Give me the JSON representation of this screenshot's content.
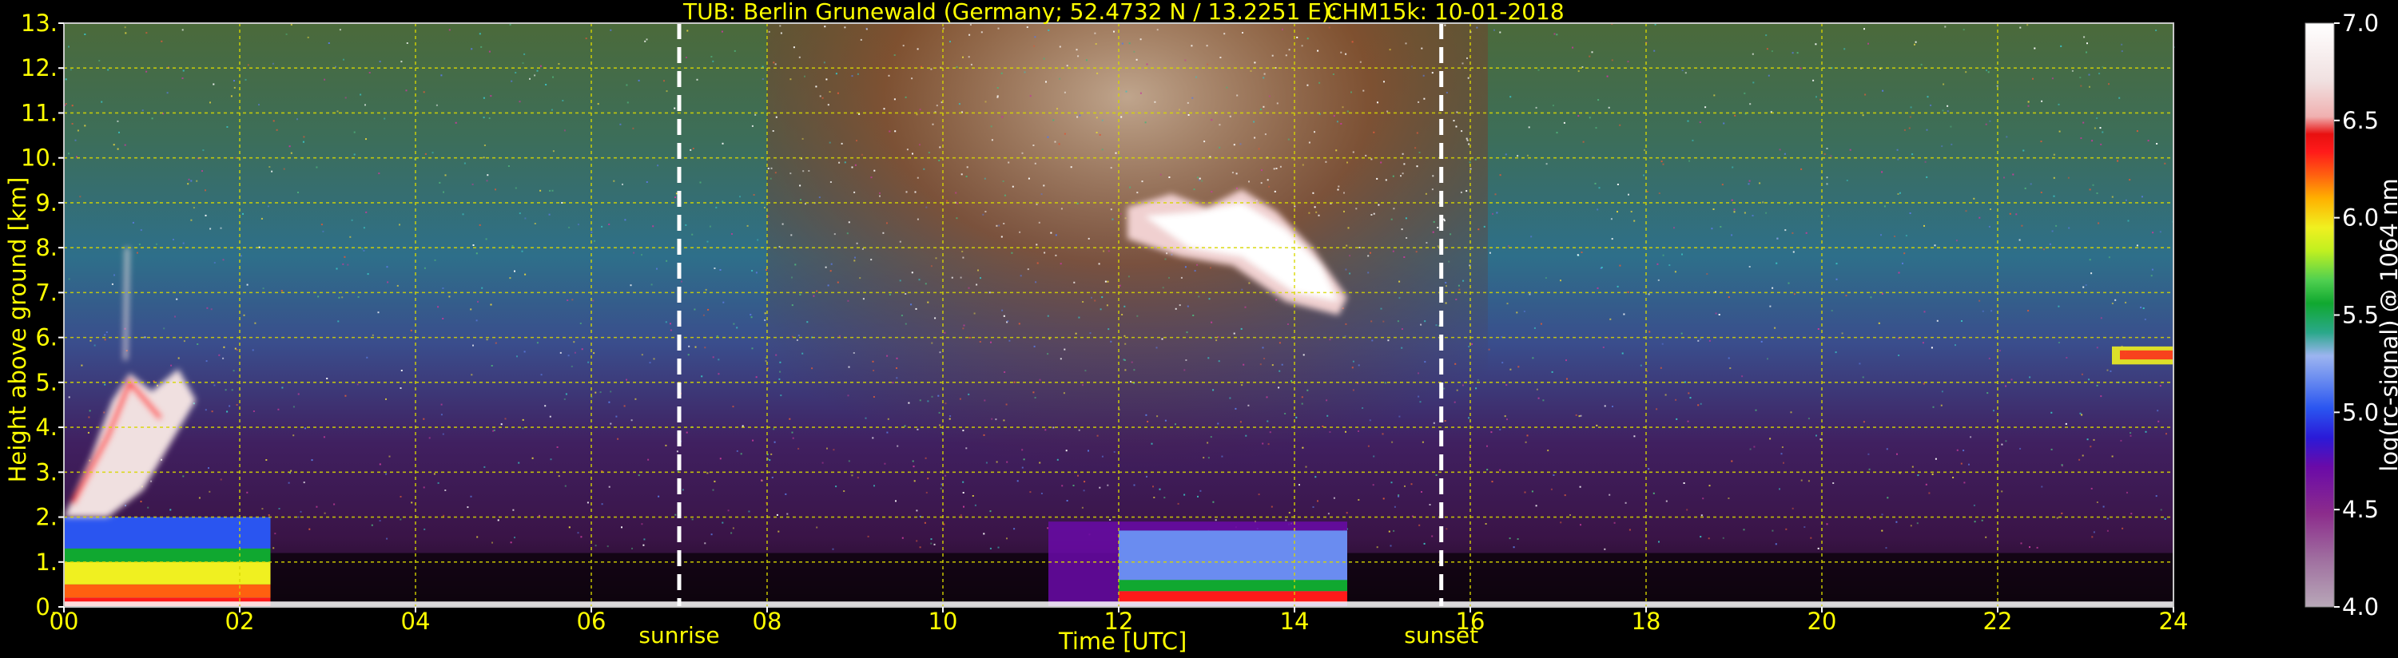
{
  "chart_data": {
    "type": "heatmap",
    "title": "TUB: Berlin Grunewald (Germany; 52.4732 N / 13.2251 E):",
    "title_right": "CHM15k: 10-01-2018",
    "xlabel": "Time [UTC]",
    "ylabel": "Height above ground [km]",
    "xlim": [
      0,
      24
    ],
    "ylim": [
      0,
      13
    ],
    "xticks": [
      "00",
      "02",
      "04",
      "06",
      "08",
      "10",
      "12",
      "14",
      "16",
      "18",
      "20",
      "22",
      "24"
    ],
    "yticks": [
      "0.",
      "1.",
      "2.",
      "3.",
      "4.",
      "5.",
      "6.",
      "7.",
      "8.",
      "9.",
      "10.",
      "11.",
      "12.",
      "13."
    ],
    "grid": true,
    "markers": [
      {
        "label": "sunrise",
        "x": 7.0
      },
      {
        "label": "sunset",
        "x": 15.67
      }
    ],
    "colorbar": {
      "label": "log(rc-signal) @ 1064 nm",
      "range": [
        4.0,
        7.0
      ],
      "ticks": [
        "4.0",
        "4.5",
        "5.0",
        "5.5",
        "6.0",
        "6.5",
        "7.0"
      ]
    },
    "features": [
      {
        "kind": "boundary-layer",
        "x": [
          0.0,
          2.35
        ],
        "y": [
          0.0,
          2.0
        ],
        "level": 6.0
      },
      {
        "kind": "aerosol-plume",
        "x": [
          0.0,
          1.5
        ],
        "y": [
          2.0,
          8.0
        ],
        "level": 6.8
      },
      {
        "kind": "boundary-layer",
        "x": [
          11.2,
          14.6
        ],
        "y": [
          0.0,
          1.9
        ],
        "level": 5.0
      },
      {
        "kind": "cirrus-cloud",
        "x": [
          12.0,
          14.6
        ],
        "y": [
          6.5,
          9.3
        ],
        "level": 7.0
      },
      {
        "kind": "aerosol-layer",
        "x": [
          23.3,
          24.0
        ],
        "y": [
          5.4,
          5.8
        ],
        "level": 6.0
      }
    ]
  }
}
